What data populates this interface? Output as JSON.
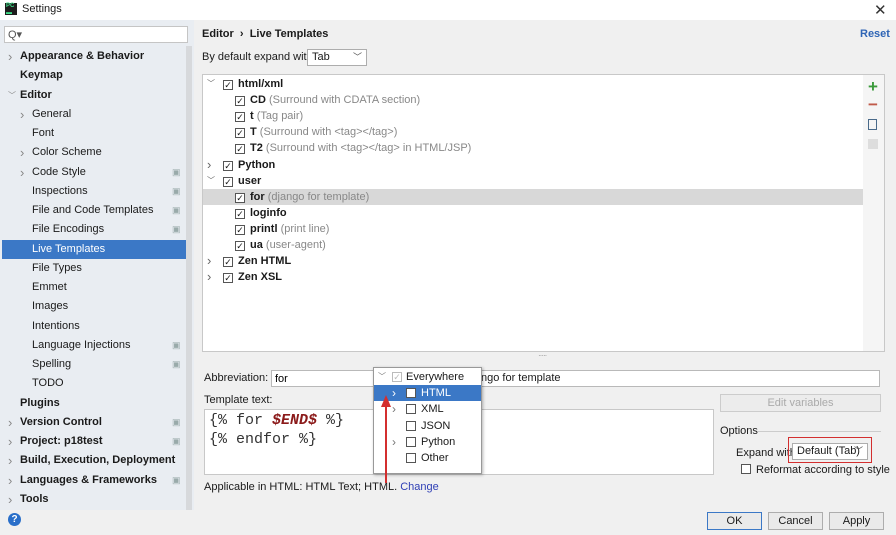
{
  "window": {
    "title": "Settings",
    "close_icon": "close-icon"
  },
  "sidebar": {
    "search_placeholder": "Q▾",
    "items": [
      {
        "label": "Appearance & Behavior",
        "level": 0,
        "bold": true,
        "chevron": ">"
      },
      {
        "label": "Keymap",
        "level": 0,
        "bold": true,
        "chevron": ""
      },
      {
        "label": "Editor",
        "level": 0,
        "bold": true,
        "chevron": "v"
      },
      {
        "label": "General",
        "level": 1,
        "chevron": ">"
      },
      {
        "label": "Font",
        "level": 1,
        "chevron": ""
      },
      {
        "label": "Color Scheme",
        "level": 1,
        "chevron": ">"
      },
      {
        "label": "Code Style",
        "level": 1,
        "chevron": ">",
        "copy": true
      },
      {
        "label": "Inspections",
        "level": 1,
        "chevron": "",
        "copy": true
      },
      {
        "label": "File and Code Templates",
        "level": 1,
        "chevron": "",
        "copy": true
      },
      {
        "label": "File Encodings",
        "level": 1,
        "chevron": "",
        "copy": true
      },
      {
        "label": "Live Templates",
        "level": 1,
        "chevron": "",
        "selected": true
      },
      {
        "label": "File Types",
        "level": 1,
        "chevron": ""
      },
      {
        "label": "Emmet",
        "level": 1,
        "chevron": ""
      },
      {
        "label": "Images",
        "level": 1,
        "chevron": ""
      },
      {
        "label": "Intentions",
        "level": 1,
        "chevron": ""
      },
      {
        "label": "Language Injections",
        "level": 1,
        "chevron": "",
        "copy": true
      },
      {
        "label": "Spelling",
        "level": 1,
        "chevron": "",
        "copy": true
      },
      {
        "label": "TODO",
        "level": 1,
        "chevron": ""
      },
      {
        "label": "Plugins",
        "level": 0,
        "bold": true,
        "chevron": ""
      },
      {
        "label": "Version Control",
        "level": 0,
        "bold": true,
        "chevron": ">",
        "copy": true
      },
      {
        "label": "Project: p18test",
        "level": 0,
        "bold": true,
        "chevron": ">",
        "copy": true
      },
      {
        "label": "Build, Execution, Deployment",
        "level": 0,
        "bold": true,
        "chevron": ">"
      },
      {
        "label": "Languages & Frameworks",
        "level": 0,
        "bold": true,
        "chevron": ">",
        "copy": true
      },
      {
        "label": "Tools",
        "level": 0,
        "bold": true,
        "chevron": ">"
      }
    ]
  },
  "header": {
    "breadcrumb_1": "Editor",
    "breadcrumb_sep": "›",
    "breadcrumb_2": "Live Templates",
    "reset": "Reset"
  },
  "expand_default": {
    "label": "By default expand with",
    "value": "Tab"
  },
  "tree": [
    {
      "name": "html/xml",
      "desc": "",
      "group": true,
      "expanded": true
    },
    {
      "name": "CD",
      "desc": "(Surround with CDATA section)"
    },
    {
      "name": "t",
      "desc": "(Tag pair)"
    },
    {
      "name": "T",
      "desc": "(Surround with <tag></tag>)"
    },
    {
      "name": "T2",
      "desc": "(Surround with <tag></tag> in HTML/JSP)"
    },
    {
      "name": "Python",
      "desc": "",
      "group": true,
      "expanded": false
    },
    {
      "name": "user",
      "desc": "",
      "group": true,
      "expanded": true
    },
    {
      "name": "for",
      "desc": "(django for template)",
      "selected": true
    },
    {
      "name": "loginfo",
      "desc": ""
    },
    {
      "name": "printl",
      "desc": "(print line)"
    },
    {
      "name": "ua",
      "desc": "(user-agent)"
    },
    {
      "name": "Zen HTML",
      "desc": "",
      "group": true,
      "expanded": false
    },
    {
      "name": "Zen XSL",
      "desc": "",
      "group": true,
      "expanded": false
    }
  ],
  "toolbar": {
    "add_icon": "plus-icon",
    "remove_icon": "minus-icon",
    "copy_icon": "copy-icon",
    "edit_icon": "template-icon"
  },
  "editor": {
    "abbreviation_label": "Abbreviation:",
    "abbreviation_value": "for",
    "description_visible": "ngo for template",
    "template_label": "Template text:",
    "line1_pre": "{% for ",
    "line1_var": "$END$",
    "line1_post": " %}",
    "line2": "{% endfor %}",
    "applicable": "Applicable in HTML: HTML Text; HTML.",
    "change_link": "Change",
    "edit_variables": "Edit variables"
  },
  "options": {
    "title": "Options",
    "expand_label": "Expand with",
    "expand_value": "Default (Tab)",
    "reformat_label": "Reformat according to style",
    "reformat_checked": false
  },
  "context_popup": [
    {
      "label": "Everywhere",
      "checked": true,
      "disabled": true,
      "chevron": "v"
    },
    {
      "label": "HTML",
      "checked": true,
      "selected": true,
      "chevron": ">"
    },
    {
      "label": "XML",
      "checked": false,
      "chevron": ">"
    },
    {
      "label": "JSON",
      "checked": false,
      "chevron": ""
    },
    {
      "label": "Python",
      "checked": false,
      "chevron": ">"
    },
    {
      "label": "Other",
      "checked": false,
      "chevron": ""
    }
  ],
  "annotation_color": "#d32f2f",
  "buttons": {
    "ok": "OK",
    "cancel": "Cancel",
    "apply": "Apply",
    "help": "?"
  }
}
